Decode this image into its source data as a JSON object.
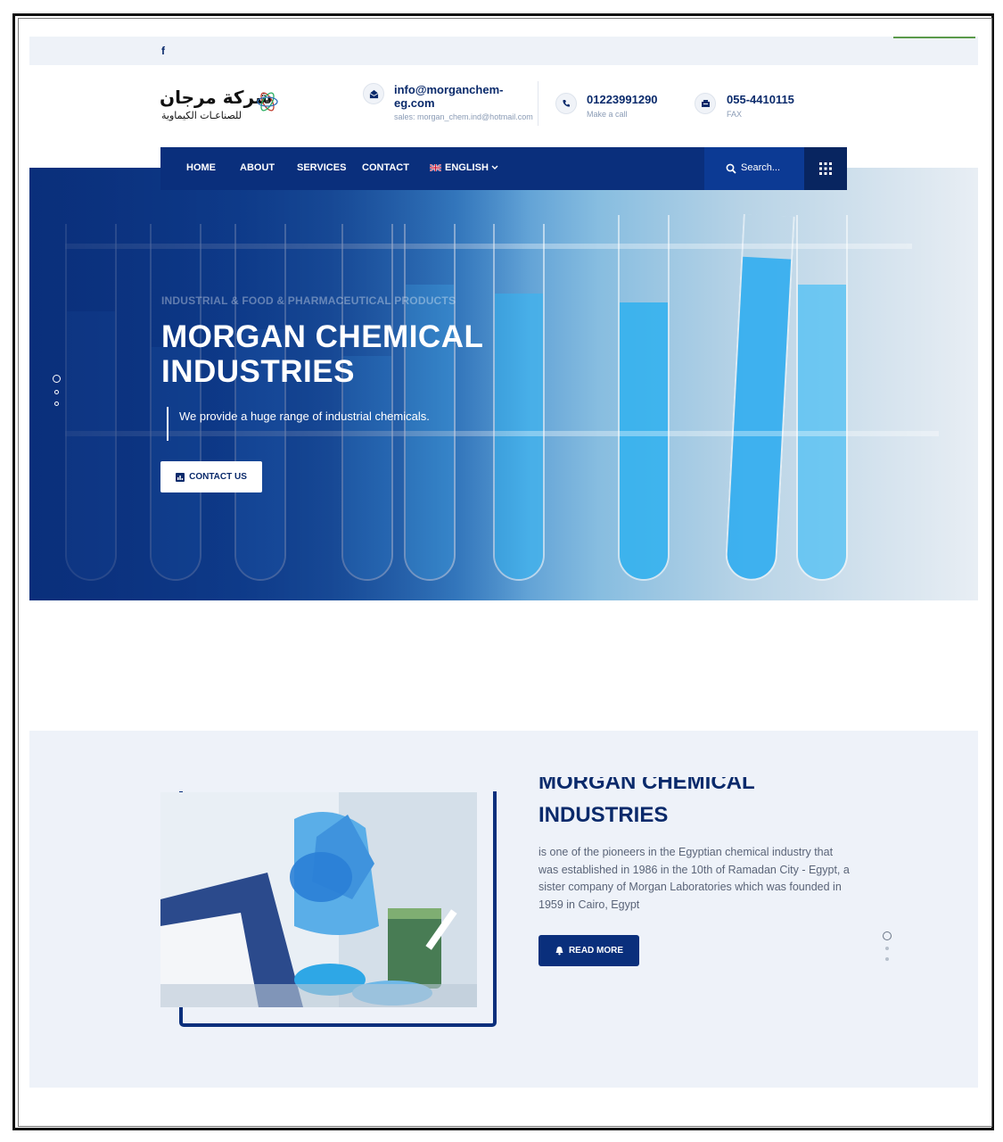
{
  "topbar": {
    "facebook": "f"
  },
  "logo": {
    "arabic_name": "شركة مرجان",
    "arabic_sub": "للصناعـات الكيماوية"
  },
  "contact": {
    "email": "info@morganchem-eg.com",
    "email_sub": "sales: morgan_chem.ind@hotmail.com",
    "phone": "01223991290",
    "phone_sub": "Make a call",
    "fax": "055-4410115",
    "fax_sub": "FAX"
  },
  "nav": {
    "items": [
      {
        "label": "HOME"
      },
      {
        "label": "ABOUT"
      },
      {
        "label": "SERVICES"
      },
      {
        "label": "CONTACT"
      },
      {
        "label": "ENGLISH"
      }
    ],
    "search_placeholder": "Search..."
  },
  "hero": {
    "subtitle": "INDUSTRIAL & FOOD & PHARMACEUTICAL PRODUCTS",
    "title_line1": "MORGAN CHEMICAL",
    "title_line2": "INDUSTRIES",
    "text": "We provide a huge range of industrial chemicals.",
    "button": "CONTACT US"
  },
  "about": {
    "title_cut": "MORGAN CHEMICAL",
    "title": "INDUSTRIES",
    "text": "is one of the pioneers in the Egyptian chemical industry that was established in 1986 in the 10th of Ramadan City - Egypt, a sister company of Morgan Laboratories which was founded in 1959 in Cairo, Egypt",
    "button": "READ MORE"
  },
  "colors": {
    "primary": "#0a2f7c",
    "light_bg": "#eef2f9",
    "accent_green": "#5a9a4a"
  }
}
